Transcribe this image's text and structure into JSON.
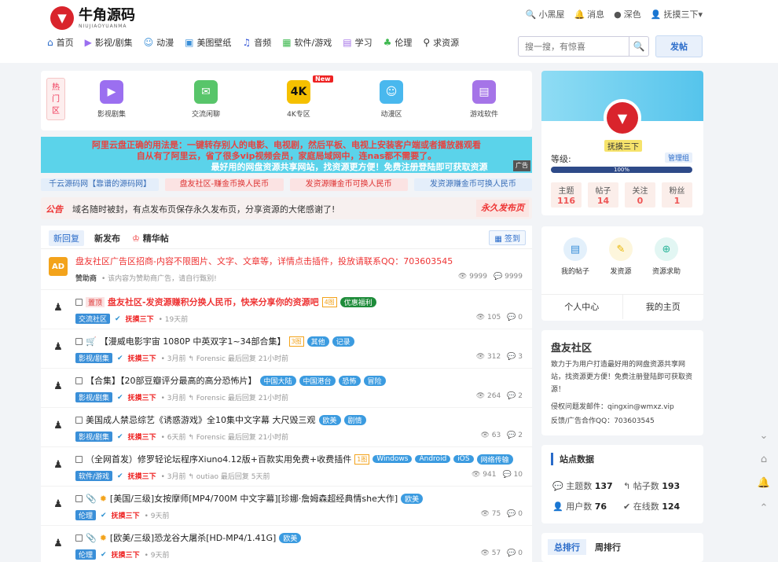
{
  "header": {
    "logo_mark": "▼",
    "logo_cn": "牛角源码",
    "logo_en": "NIUJIAOYUANMA",
    "links": [
      {
        "icon": "🔍",
        "label": "小黑屋"
      },
      {
        "icon": "🔔",
        "label": "消息"
      },
      {
        "icon": "●",
        "label": "深色"
      },
      {
        "icon": "👤",
        "label": "抚摸三下▾"
      }
    ]
  },
  "nav": [
    {
      "icon": "⌂",
      "label": "首页"
    },
    {
      "icon": "▶",
      "label": "影视/剧集"
    },
    {
      "icon": "☺",
      "label": "动漫"
    },
    {
      "icon": "▣",
      "label": "美图壁纸"
    },
    {
      "icon": "♫",
      "label": "音频"
    },
    {
      "icon": "▦",
      "label": "软件/游戏"
    },
    {
      "icon": "▤",
      "label": "学习"
    },
    {
      "icon": "♣",
      "label": "伦理"
    },
    {
      "icon": "⚲",
      "label": "求资源"
    }
  ],
  "search": {
    "placeholder": "搜一搜，有惊喜",
    "icon": "🔍"
  },
  "post_button": "发帖",
  "hot": {
    "tag": [
      "热",
      "门",
      "区"
    ],
    "items": [
      {
        "label": "影视剧集",
        "icon": "▶",
        "color": "#9b6ff0"
      },
      {
        "label": "交流闲聊",
        "icon": "✉",
        "color": "#58c56a"
      },
      {
        "label": "4K专区",
        "icon": "4K",
        "color": "#f5c000",
        "badge": "New"
      },
      {
        "label": "动漫区",
        "icon": "☺",
        "color": "#49b8ee"
      },
      {
        "label": "游戏软件",
        "icon": "▤",
        "color": "#a574e8"
      }
    ]
  },
  "announcement": {
    "line1": "阿里云盘正确的用法是：一键转存别人的电影、电视剧，然后平板、电视上安装客户端或者播放器观看",
    "line2": "自从有了阿里云，省了很多vip视频会员，家庭局域网中，连nas都不需要了。",
    "line3": "最好用的网盘资源共享网站，找资源更方便！免费注册登陆即可获取资源",
    "ad": "广告"
  },
  "links": [
    "千云源码网【靠谱的源码网】",
    "盘友社区-赚金币换人民币",
    "发资源赚金币可换人民币",
    "发资源赚金币可换人民币"
  ],
  "notice": {
    "label": "公告",
    "text": "域名随时被封，有点发布页保存永久发布页，分享资源的大佬感谢了!",
    "button": "永久发布页"
  },
  "tabs": {
    "items": [
      "新回复",
      "新发布",
      "精华帖"
    ],
    "signin": "签到"
  },
  "posts": [
    {
      "avatar": "AD",
      "title": "盘友社区广告区招商-内容不限图片、文字、文章等，详情点击插件，投放请联系QQ：703603545",
      "cat": "赞助商",
      "user": "",
      "meta": "• 该内容为赞助商广告，请自行甄别!",
      "views": "9999",
      "replies": "9999",
      "red": true,
      "tags": []
    },
    {
      "avatar": "♟",
      "title": "盘友社区-发资源赚积分换人民币，快来分享你的资源吧",
      "prefix": "置顶",
      "cat": "交流社区",
      "user": "抚摸三下",
      "meta": "• 19天前",
      "views": "105",
      "replies": "0",
      "red": true,
      "tags": [
        "4图",
        "优惠福利"
      ]
    },
    {
      "avatar": "♟",
      "title": "【漫威电影宇宙 1080P 中英双字1~34部合集】",
      "prefix": "",
      "cat": "影视/剧集",
      "user": "抚摸三下",
      "meta": "• 3月前  ↰ Forensic  最后回复 21小时前",
      "views": "312",
      "replies": "3",
      "red": false,
      "tags": [
        "3图",
        "其他",
        "记录"
      ]
    },
    {
      "avatar": "♟",
      "title": "【合集】【20部豆瓣评分最高的高分恐怖片】",
      "prefix": "",
      "cat": "影视/剧集",
      "user": "抚摸三下",
      "meta": "• 3月前  ↰ Forensic  最后回复 21小时前",
      "views": "264",
      "replies": "2",
      "red": false,
      "tags": [
        "中国大陆",
        "中国港台",
        "恐怖",
        "冒险"
      ]
    },
    {
      "avatar": "♟",
      "title": "美国成人禁忌综艺《诱惑游戏》全10集中文字幕 大尺毁三观",
      "prefix": "",
      "cat": "影视/剧集",
      "user": "抚摸三下",
      "meta": "• 6天前  ↰ Forensic  最后回复 21小时前",
      "views": "63",
      "replies": "2",
      "red": false,
      "tags": [
        "欧美",
        "剧情"
      ]
    },
    {
      "avatar": "♟",
      "title": "（全网首发）修罗轻论坛程序Xiuno4.12版+百款实用免费+收费插件",
      "prefix": "",
      "cat": "软件/游戏",
      "user": "抚摸三下",
      "meta": "• 3月前  ↰ outiao  最后回复 5天前",
      "views": "941",
      "replies": "10",
      "red": false,
      "tags": [
        "1图",
        "Windows",
        "Android",
        "iOS",
        "网络传输"
      ]
    },
    {
      "avatar": "♟",
      "title": "[美国/三级]女按摩师[MP4/700M 中文字幕][珍娜·詹姆森超经典情she大作]",
      "prefix": "",
      "cat": "伦理",
      "user": "抚摸三下",
      "meta": "• 9天前",
      "views": "75",
      "replies": "0",
      "red": false,
      "tags": [
        "欧美"
      ]
    },
    {
      "avatar": "♟",
      "title": "[欧美/三级]恐龙谷大屠杀[HD-MP4/1.41G]",
      "prefix": "",
      "cat": "伦理",
      "user": "抚摸三下",
      "meta": "• 9天前",
      "views": "57",
      "replies": "0",
      "red": false,
      "tags": [
        "欧美"
      ]
    }
  ],
  "profile": {
    "name": "抚摸三下",
    "level_label": "等级:",
    "role": "管理组",
    "progress": "100%",
    "stats": [
      {
        "label": "主题",
        "value": "116"
      },
      {
        "label": "帖子",
        "value": "14"
      },
      {
        "label": "关注",
        "value": "0"
      },
      {
        "label": "粉丝",
        "value": "1"
      }
    ]
  },
  "quick": {
    "items": [
      {
        "label": "我的帖子",
        "icon": "▤",
        "bg": "#e3f0fb",
        "color": "#3a8fd8"
      },
      {
        "label": "发资源",
        "icon": "✎",
        "bg": "#fdf6dc",
        "color": "#e8b400"
      },
      {
        "label": "资源求助",
        "icon": "⊕",
        "bg": "#e2f6f3",
        "color": "#2ab59a"
      }
    ],
    "center": "个人中心",
    "home": "我的主页"
  },
  "about": {
    "title": "盘友社区",
    "desc": "致力于为用户打造最好用的网盘资源共享网站，找资源更方便！免费注册登陆即可获取资源！",
    "contact1": "侵权问题发邮件：qingxin@wmxz.vip",
    "contact2": "反馈/广告合作QQ：703603545"
  },
  "site_stats": {
    "title": "站点数据",
    "items": [
      {
        "label": "主题数",
        "value": "137"
      },
      {
        "label": "帖子数",
        "value": "193"
      },
      {
        "label": "用户数",
        "value": "76"
      },
      {
        "label": "在线数",
        "value": "124"
      }
    ]
  },
  "rank": {
    "tabs": [
      "总排行",
      "周排行"
    ]
  },
  "float_icons": [
    "⌄",
    "⌂",
    "🔔",
    "⌃"
  ]
}
